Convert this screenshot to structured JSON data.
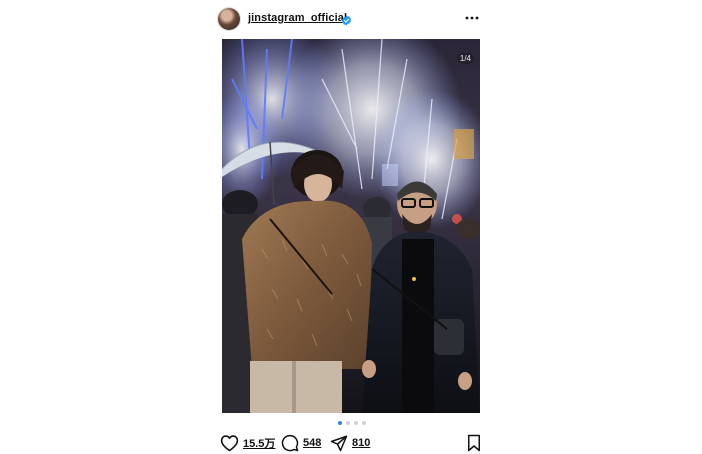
{
  "post": {
    "username": "jinstagram_official",
    "verified": true,
    "image_counter": "1/4",
    "carousel": {
      "total": 4,
      "active_index": 0
    },
    "likes": "15.5万",
    "comments": "548",
    "shares": "810"
  },
  "icons": {
    "verified": "verified-badge-icon",
    "more": "more-options-icon",
    "like": "heart-icon",
    "comment": "comment-icon",
    "share": "paper-plane-icon",
    "save": "bookmark-icon"
  },
  "colors": {
    "accent": "#3b82f6",
    "verified": "#1d9bf0",
    "text": "#111111"
  }
}
